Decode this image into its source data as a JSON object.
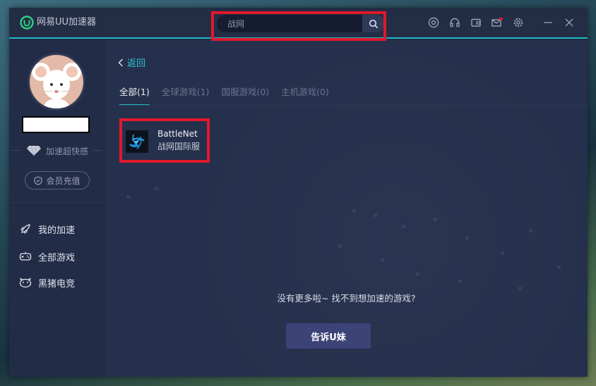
{
  "app": {
    "title": "网易UU加速器"
  },
  "search": {
    "value": "战网",
    "placeholder": ""
  },
  "sidebar": {
    "badge_label": "加速超快感",
    "vip_label": "会员充值",
    "items": [
      {
        "label": "我的加速",
        "icon": "rocket-icon"
      },
      {
        "label": "全部游戏",
        "icon": "gamepad-icon"
      },
      {
        "label": "黑猪电竞",
        "icon": "pig-icon"
      }
    ]
  },
  "main": {
    "back_label": "返回",
    "tabs": [
      {
        "label": "全部(1)",
        "active": true
      },
      {
        "label": "全球游戏(1)",
        "active": false
      },
      {
        "label": "国服游戏(0)",
        "active": false
      },
      {
        "label": "主机游戏(0)",
        "active": false
      }
    ],
    "results": [
      {
        "name": "BattleNet",
        "subtitle": "战网国际服",
        "icon": "battlenet-icon"
      }
    ],
    "empty_message": "没有更多啦~ 找不到想加速的游戏?",
    "tell_button": "告诉U妹"
  },
  "colors": {
    "accent": "#1fb8c7",
    "highlight": "#e0192b",
    "button": "#3b4377",
    "background": "#25304c"
  }
}
